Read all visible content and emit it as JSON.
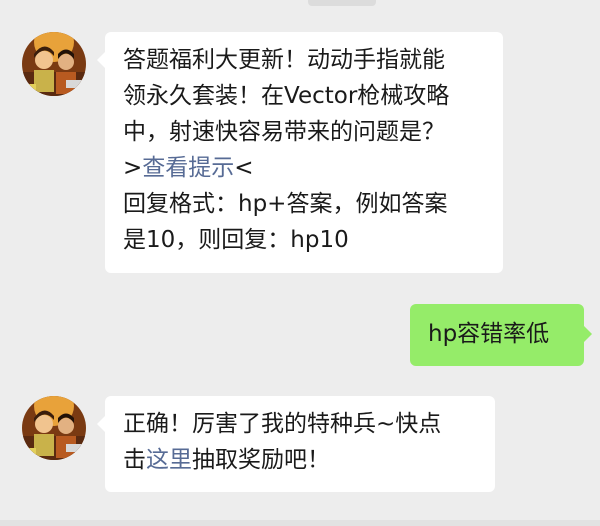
{
  "chat": {
    "msg1": {
      "avatar": "game-character-avatar",
      "lines": [
        "答题福利大更新！动动手指就能",
        "领永久套装！在Vector枪械攻略",
        "中，射速快容易带来的问题是？"
      ],
      "hint_open": ">",
      "hint_link": "查看提示",
      "hint_close": "<",
      "format_lines": [
        "回复格式：hp+答案，例如答案",
        "是10，则回复：hp10"
      ]
    },
    "msg2": {
      "text": "hp容错率低"
    },
    "msg3": {
      "avatar": "game-character-avatar",
      "line1": "正确！厉害了我的特种兵~快点",
      "line2_prefix": "击",
      "line2_link": "这里",
      "line2_suffix": "抽取奖励吧！"
    }
  },
  "colors": {
    "background": "#ededed",
    "incoming_bubble": "#ffffff",
    "outgoing_bubble": "#95ec69",
    "link": "#576b95"
  }
}
